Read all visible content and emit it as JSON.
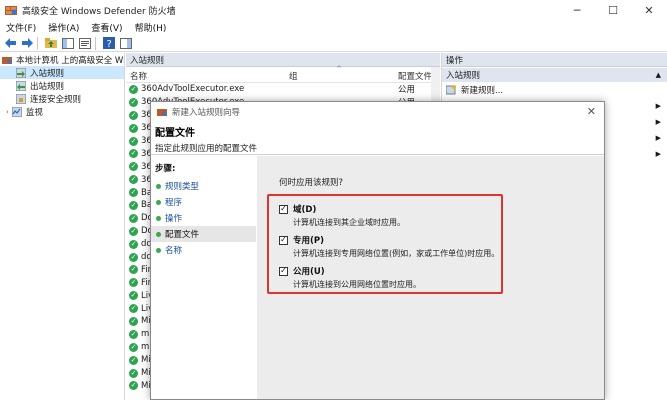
{
  "window": {
    "title": "高级安全 Windows Defender 防火墙",
    "minimize": "─",
    "maximize": "☐",
    "close": "✕"
  },
  "menu": [
    "文件(F)",
    "操作(A)",
    "查看(V)",
    "帮助(H)"
  ],
  "tree": {
    "root": "本地计算机 上的高级安全 Wind",
    "items": [
      "入站规则",
      "出站规则",
      "连接安全规则",
      "监视"
    ]
  },
  "rules": {
    "header": "入站规则",
    "columns": {
      "name": "名称",
      "group": "组",
      "profile": "配置文件"
    },
    "rows": [
      {
        "name": "360AdvToolExecutor.exe",
        "profile": "公用"
      },
      {
        "name": "360AdvToolExecutor.exe",
        "profile": "公用"
      },
      {
        "name": "36",
        "profile": ""
      },
      {
        "name": "36",
        "profile": ""
      },
      {
        "name": "36",
        "profile": ""
      },
      {
        "name": "36",
        "profile": ""
      },
      {
        "name": "36",
        "profile": ""
      },
      {
        "name": "36",
        "profile": ""
      },
      {
        "name": "Ba",
        "profile": ""
      },
      {
        "name": "Ba",
        "profile": ""
      },
      {
        "name": "Dc",
        "profile": ""
      },
      {
        "name": "Dc",
        "profile": ""
      },
      {
        "name": "dc",
        "profile": ""
      },
      {
        "name": "dc",
        "profile": ""
      },
      {
        "name": "Fir",
        "profile": ""
      },
      {
        "name": "Fir",
        "profile": ""
      },
      {
        "name": "Liv",
        "profile": ""
      },
      {
        "name": "Liv",
        "profile": ""
      },
      {
        "name": "Mi",
        "profile": ""
      },
      {
        "name": "mi",
        "profile": ""
      },
      {
        "name": "mi",
        "profile": ""
      },
      {
        "name": "Mi",
        "profile": ""
      },
      {
        "name": "Mi",
        "profile": ""
      },
      {
        "name": "Mi",
        "profile": ""
      }
    ]
  },
  "actions": {
    "header": "操作",
    "sub": "入站规则",
    "items": [
      "新建规则..."
    ]
  },
  "wizard": {
    "title": "新建入站规则向导",
    "heading": "配置文件",
    "subheading": "指定此规则应用的配置文件",
    "steps_title": "步骤:",
    "steps": [
      "规则类型",
      "程序",
      "操作",
      "配置文件",
      "名称"
    ],
    "question": "何时应用该规则?",
    "options": [
      {
        "label": "域(D)",
        "desc": "计算机连接到其企业域时应用。",
        "checked": true
      },
      {
        "label": "专用(P)",
        "desc": "计算机连接到专用网络位置(例如，家或工作单位)时应用。",
        "checked": true
      },
      {
        "label": "公用(U)",
        "desc": "计算机连接到公用网络位置时应用。",
        "checked": true
      }
    ],
    "check_mark": "✓",
    "close_glyph": "✕"
  },
  "colors": {
    "highlight_border": "#e0322f",
    "rule_enabled": "#2da44e",
    "selection": "#cce8ff"
  }
}
